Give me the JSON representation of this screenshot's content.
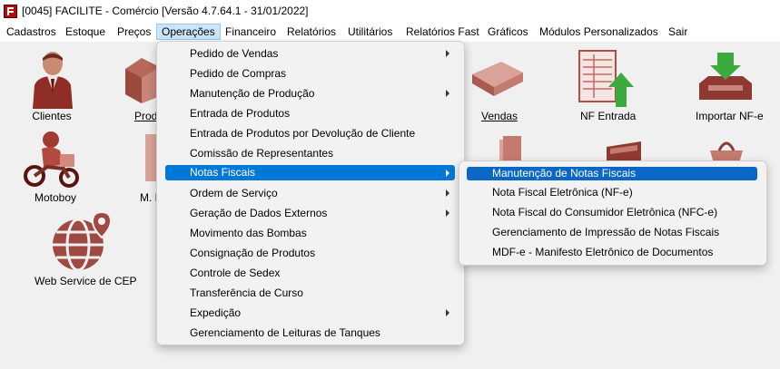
{
  "window": {
    "title": "[0045] FACILITE - Comércio [Versão 4.7.64.1 - 31/01/2022]",
    "icon": "app-logo-icon"
  },
  "menubar": [
    {
      "label": "Cadastros"
    },
    {
      "label": "Estoque"
    },
    {
      "label": "Preços"
    },
    {
      "label": "Operações"
    },
    {
      "label": "Financeiro"
    },
    {
      "label": "Relatórios"
    },
    {
      "label": "Utilitários"
    },
    {
      "label": "Relatórios Fast"
    },
    {
      "label": "Gráficos"
    },
    {
      "label": "Módulos Personalizados"
    },
    {
      "label": "Sair"
    }
  ],
  "desktop": {
    "clientes": "Clientes",
    "produtos": "Prod",
    "vendas": "Vendas",
    "nf_entrada": "NF Entrada",
    "importar_nfe": "Importar NF-e",
    "motoboy": "Motoboy",
    "m_f": "M. F",
    "web_service_cep": "Web Service de CEP"
  },
  "operacoes_menu": [
    {
      "label": "Pedido de Vendas",
      "submenu": true
    },
    {
      "label": "Pedido de Compras",
      "submenu": false
    },
    {
      "label": "Manutenção de Produção",
      "submenu": true
    },
    {
      "label": "Entrada de Produtos",
      "submenu": false
    },
    {
      "label": "Entrada de Produtos por Devolução de Cliente",
      "submenu": false
    },
    {
      "label": "Comissão de Representantes",
      "submenu": false
    },
    {
      "label": "Notas Fiscais",
      "submenu": true,
      "selected": true
    },
    {
      "label": "Ordem de Serviço",
      "submenu": true
    },
    {
      "label": "Geração de Dados Externos",
      "submenu": true
    },
    {
      "label": "Movimento das Bombas",
      "submenu": false
    },
    {
      "label": "Consignação de Produtos",
      "submenu": false
    },
    {
      "label": "Controle de Sedex",
      "submenu": false
    },
    {
      "label": "Transferência de Curso",
      "submenu": false
    },
    {
      "label": "Expedição",
      "submenu": true
    },
    {
      "label": "Gerenciamento de Leituras de Tanques",
      "submenu": false
    }
  ],
  "notas_fiscais_menu": [
    {
      "label": "Manutenção de Notas Fiscais",
      "selected": true
    },
    {
      "label": "Nota Fiscal Eletrônica (NF-e)"
    },
    {
      "label": "Nota Fiscal do Consumidor Eletrônica (NFC-e)"
    },
    {
      "label": "Gerenciamento de Impressão de Notas Fiscais"
    },
    {
      "label": "MDF-e - Manifesto Eletrônico de Documentos"
    }
  ],
  "colors": {
    "selection": "#0078d7",
    "icon_red": "#8b2b2b",
    "menu_bg": "#f2f2f2"
  }
}
